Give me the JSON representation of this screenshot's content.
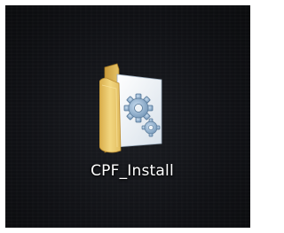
{
  "desktop": {
    "background_color": "#101115",
    "icons": [
      {
        "label": "CPF_Install",
        "icon": "folder-with-gears-icon",
        "folder_color": "#e9c96b",
        "document_color": "#eef3f7",
        "gear_color": "#8fb1cf"
      }
    ]
  }
}
